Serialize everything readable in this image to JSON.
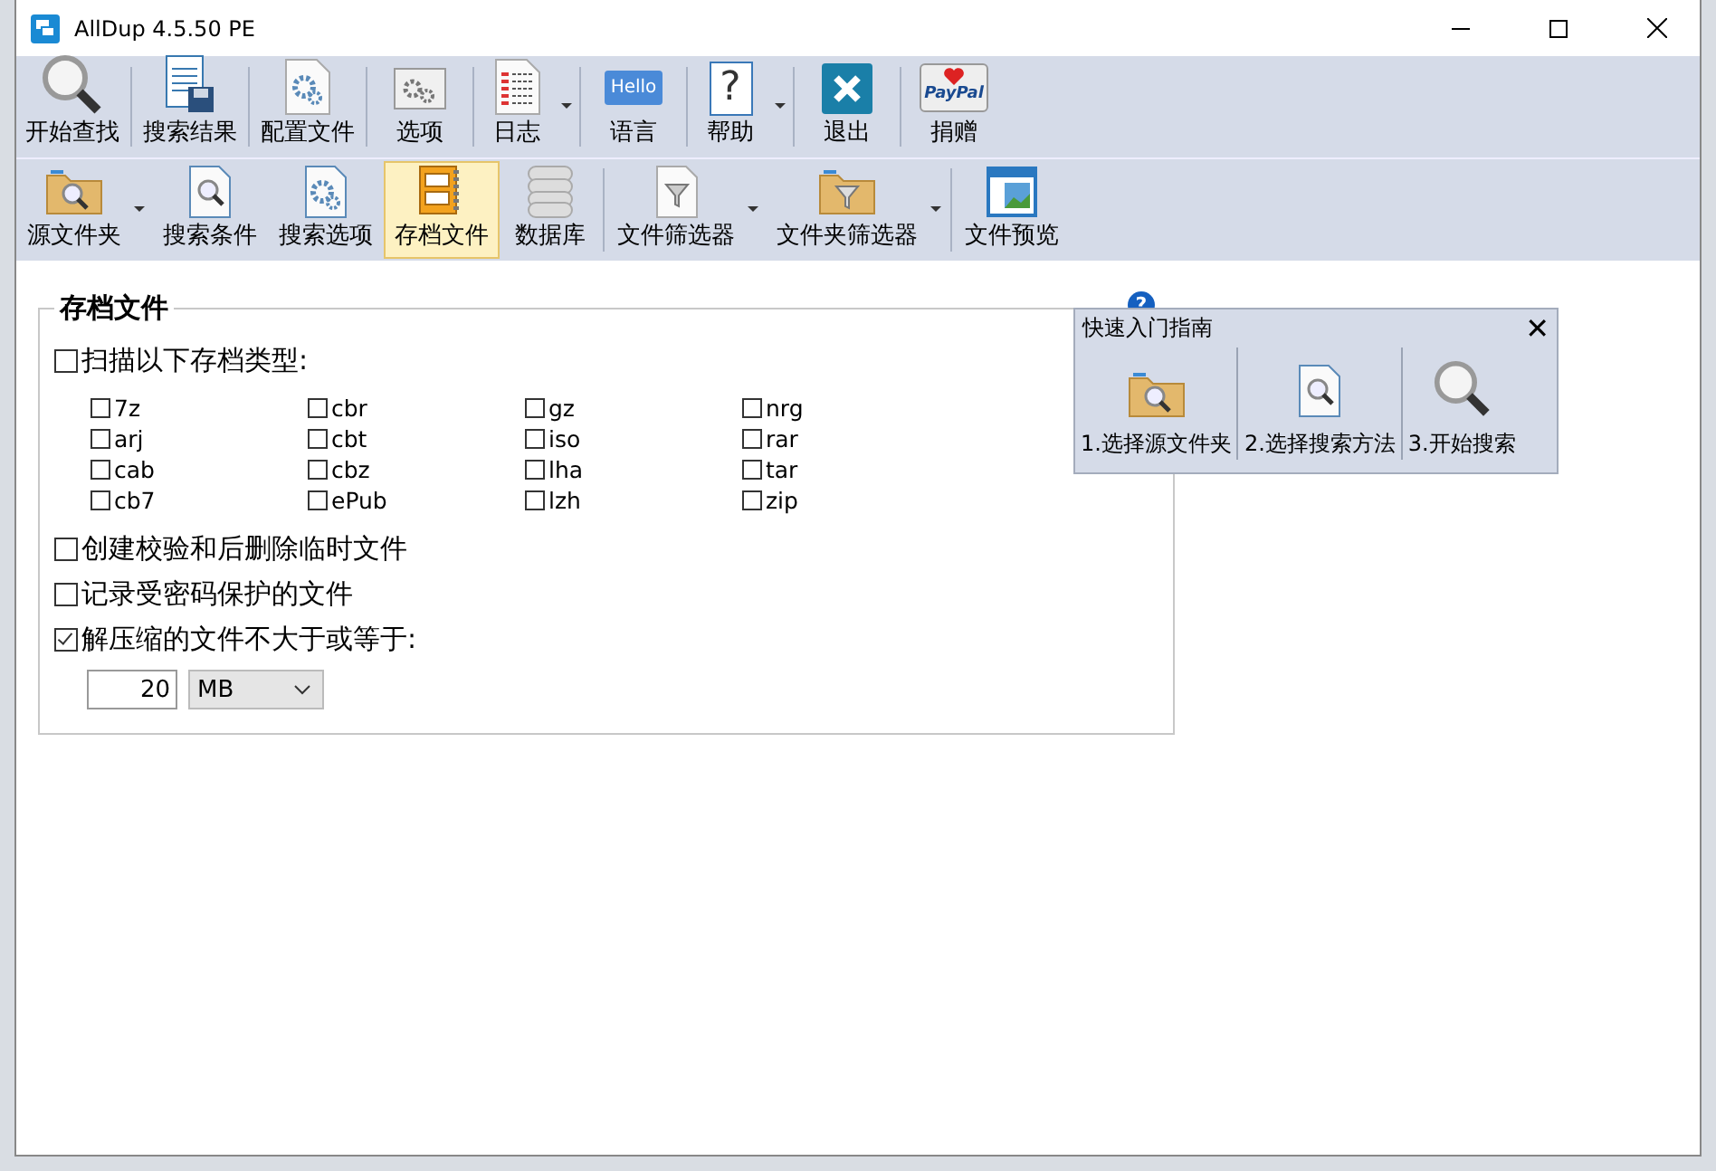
{
  "window": {
    "title": "AllDup 4.5.50 PE"
  },
  "main_toolbar": [
    {
      "label": "开始查找",
      "dropdown": false
    },
    {
      "label": "搜索结果",
      "dropdown": false
    },
    {
      "label": "配置文件",
      "dropdown": false
    },
    {
      "label": "选项",
      "dropdown": false
    },
    {
      "label": "日志",
      "dropdown": true
    },
    {
      "label": "语言",
      "dropdown": false,
      "icon_text": "Hello"
    },
    {
      "label": "帮助",
      "dropdown": true,
      "icon_text": "?"
    },
    {
      "label": "退出",
      "dropdown": false
    },
    {
      "label": "捐赠",
      "dropdown": false,
      "icon_text": "PayPal"
    }
  ],
  "sub_toolbar": [
    {
      "label": "源文件夹",
      "dropdown": true,
      "selected": false
    },
    {
      "label": "搜索条件",
      "dropdown": false,
      "selected": false
    },
    {
      "label": "搜索选项",
      "dropdown": false,
      "selected": false
    },
    {
      "label": "存档文件",
      "dropdown": false,
      "selected": true
    },
    {
      "label": "数据库",
      "dropdown": false,
      "selected": false
    },
    {
      "label": "文件筛选器",
      "dropdown": true,
      "selected": false
    },
    {
      "label": "文件夹筛选器",
      "dropdown": true,
      "selected": false
    },
    {
      "label": "文件预览",
      "dropdown": false,
      "selected": false
    }
  ],
  "panel": {
    "title": "存档文件",
    "scan": {
      "label": "扫描以下存档类型:",
      "checked": false
    },
    "archive_types": [
      {
        "label": "7z",
        "checked": false
      },
      {
        "label": "cbr",
        "checked": false
      },
      {
        "label": "gz",
        "checked": false
      },
      {
        "label": "nrg",
        "checked": false
      },
      {
        "label": "arj",
        "checked": false
      },
      {
        "label": "cbt",
        "checked": false
      },
      {
        "label": "iso",
        "checked": false
      },
      {
        "label": "rar",
        "checked": false
      },
      {
        "label": "cab",
        "checked": false
      },
      {
        "label": "cbz",
        "checked": false
      },
      {
        "label": "lha",
        "checked": false
      },
      {
        "label": "tar",
        "checked": false
      },
      {
        "label": "cb7",
        "checked": false
      },
      {
        "label": "ePub",
        "checked": false
      },
      {
        "label": "lzh",
        "checked": false
      },
      {
        "label": "zip",
        "checked": false
      }
    ],
    "options": [
      {
        "label": "创建校验和后删除临时文件",
        "checked": false
      },
      {
        "label": "记录受密码保护的文件",
        "checked": false
      },
      {
        "label": "解压缩的文件不大于或等于:",
        "checked": true
      }
    ],
    "size_value": "20",
    "size_unit": "MB"
  },
  "quick_guide": {
    "help_mark": "?",
    "title": "快速入门指南",
    "close": "✕",
    "steps": [
      {
        "label": "1.选择源文件夹"
      },
      {
        "label": "2.选择搜索方法"
      },
      {
        "label": "3.开始搜索"
      }
    ]
  }
}
